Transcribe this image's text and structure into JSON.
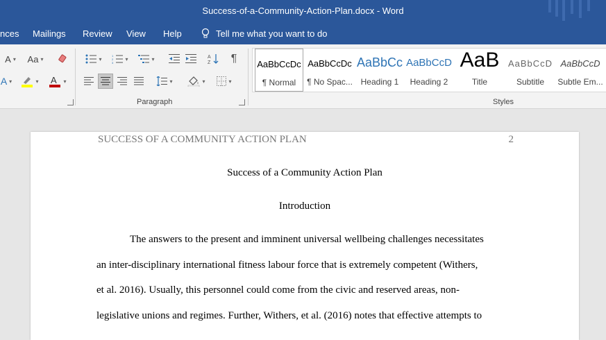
{
  "window": {
    "title": "Success-of-a-Community-Action-Plan.docx  -  Word"
  },
  "tabs": [
    "nces",
    "Mailings",
    "Review",
    "View",
    "Help"
  ],
  "tell_me": "Tell me what you want to do",
  "ribbon": {
    "font_group": {
      "case_label": "Aa",
      "size_label": "A"
    },
    "paragraph_group": {
      "label": "Paragraph"
    },
    "styles_group": {
      "label": "Styles",
      "items": [
        {
          "preview": "AaBbCcDc",
          "name": "¶ Normal"
        },
        {
          "preview": "AaBbCcDc",
          "name": "¶ No Spac..."
        },
        {
          "preview": "AaBbCc",
          "name": "Heading 1"
        },
        {
          "preview": "AaBbCcD",
          "name": "Heading 2"
        },
        {
          "preview": "AaB",
          "name": "Title"
        },
        {
          "preview": "AaBbCcD",
          "name": "Subtitle"
        },
        {
          "preview": "AaBbCcD",
          "name": "Subtle Em..."
        }
      ]
    }
  },
  "document": {
    "running_head": "SUCCESS OF A COMMUNITY ACTION PLAN",
    "page_number": "2",
    "title": "Success of a Community Action Plan",
    "section_heading": "Introduction",
    "lines": [
      "The answers to the present and imminent universal wellbeing challenges necessitates",
      "an inter-disciplinary international fitness labour force that is extremely competent (Withers,",
      "et al. 2016). Usually, this personnel could come from the civic and reserved areas, non-",
      "legislative unions and regimes. Further, Withers, et al. (2016) notes that effective attempts to"
    ]
  },
  "colors": {
    "brand": "#2b579a",
    "accent_red": "#c00000",
    "accent_yellow": "#ffff00"
  }
}
